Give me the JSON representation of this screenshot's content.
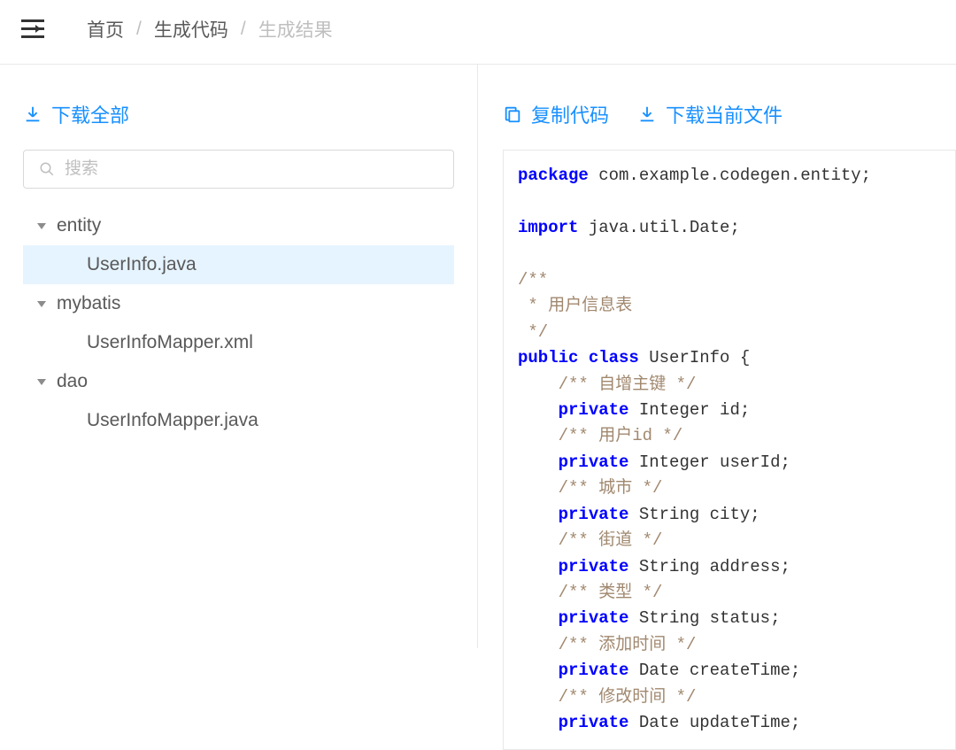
{
  "header": {
    "breadcrumb": [
      "首页",
      "生成代码",
      "生成结果"
    ]
  },
  "left": {
    "download_all_label": "下载全部",
    "search_placeholder": "搜索",
    "tree": [
      {
        "type": "folder",
        "label": "entity"
      },
      {
        "type": "file",
        "label": "UserInfo.java",
        "selected": true
      },
      {
        "type": "folder",
        "label": "mybatis"
      },
      {
        "type": "file",
        "label": "UserInfoMapper.xml",
        "selected": false
      },
      {
        "type": "folder",
        "label": "dao"
      },
      {
        "type": "file",
        "label": "UserInfoMapper.java",
        "selected": false
      }
    ]
  },
  "right": {
    "copy_code_label": "复制代码",
    "download_current_label": "下载当前文件",
    "code_tokens": [
      {
        "t": "package",
        "c": "kw"
      },
      {
        "t": " com.example.codegen.entity;\n\n"
      },
      {
        "t": "import",
        "c": "kw"
      },
      {
        "t": " java.util.Date;\n\n"
      },
      {
        "t": "/**\n * 用户信息表\n */\n",
        "c": "cm"
      },
      {
        "t": "public",
        "c": "kw"
      },
      {
        "t": " "
      },
      {
        "t": "class",
        "c": "kw"
      },
      {
        "t": " UserInfo {\n"
      },
      {
        "t": "    /** 自增主键 */\n",
        "c": "cm"
      },
      {
        "t": "    "
      },
      {
        "t": "private",
        "c": "kw"
      },
      {
        "t": " Integer id;\n"
      },
      {
        "t": "    /** 用户id */\n",
        "c": "cm"
      },
      {
        "t": "    "
      },
      {
        "t": "private",
        "c": "kw"
      },
      {
        "t": " Integer userId;\n"
      },
      {
        "t": "    /** 城市 */\n",
        "c": "cm"
      },
      {
        "t": "    "
      },
      {
        "t": "private",
        "c": "kw"
      },
      {
        "t": " String city;\n"
      },
      {
        "t": "    /** 街道 */\n",
        "c": "cm"
      },
      {
        "t": "    "
      },
      {
        "t": "private",
        "c": "kw"
      },
      {
        "t": " String address;\n"
      },
      {
        "t": "    /** 类型 */\n",
        "c": "cm"
      },
      {
        "t": "    "
      },
      {
        "t": "private",
        "c": "kw"
      },
      {
        "t": " String status;\n"
      },
      {
        "t": "    /** 添加时间 */\n",
        "c": "cm"
      },
      {
        "t": "    "
      },
      {
        "t": "private",
        "c": "kw"
      },
      {
        "t": " Date createTime;\n"
      },
      {
        "t": "    /** 修改时间 */\n",
        "c": "cm"
      },
      {
        "t": "    "
      },
      {
        "t": "private",
        "c": "kw"
      },
      {
        "t": " Date updateTime;"
      }
    ]
  }
}
